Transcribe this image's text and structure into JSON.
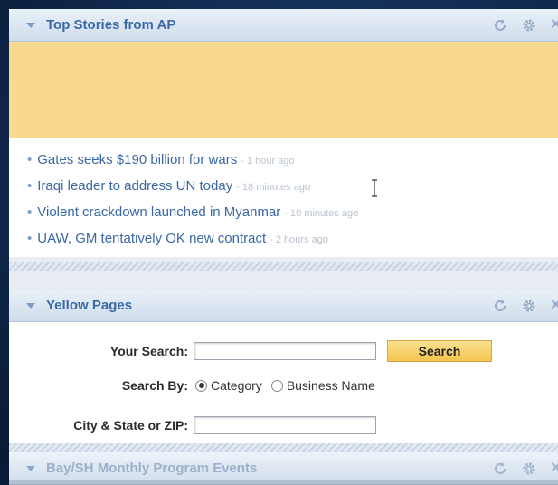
{
  "ap_widget": {
    "title": "Top Stories from AP",
    "stories": [
      {
        "headline": "Gates seeks $190 billion for wars",
        "age": "- 1 hour ago"
      },
      {
        "headline": "Iraqi leader to address UN today",
        "age": "- 18 minutes ago"
      },
      {
        "headline": "Violent crackdown launched in Myanmar",
        "age": "- 10 minutes ago"
      },
      {
        "headline": "UAW, GM tentatively OK new contract",
        "age": "- 2 hours ago"
      }
    ]
  },
  "yellow_pages": {
    "title": "Yellow Pages",
    "your_search_label": "Your Search:",
    "search_value": "",
    "search_button": "Search",
    "search_by_label": "Search By:",
    "option_category": "Category",
    "option_business": "Business Name",
    "selected_option": "Category",
    "location_label": "City & State or ZIP:",
    "location_value": ""
  },
  "third_widget": {
    "title": "Bay/SH Monthly Program Events"
  },
  "icons": {
    "refresh": "refresh-icon",
    "settings": "gear-icon",
    "close": "close-icon",
    "collapse": "collapse-arrow-icon"
  },
  "colors": {
    "title_blue": "#3b6aa7",
    "ad_yellow": "#f9d990",
    "button_yellow": "#f4c44e",
    "backdrop": "#15305a"
  }
}
